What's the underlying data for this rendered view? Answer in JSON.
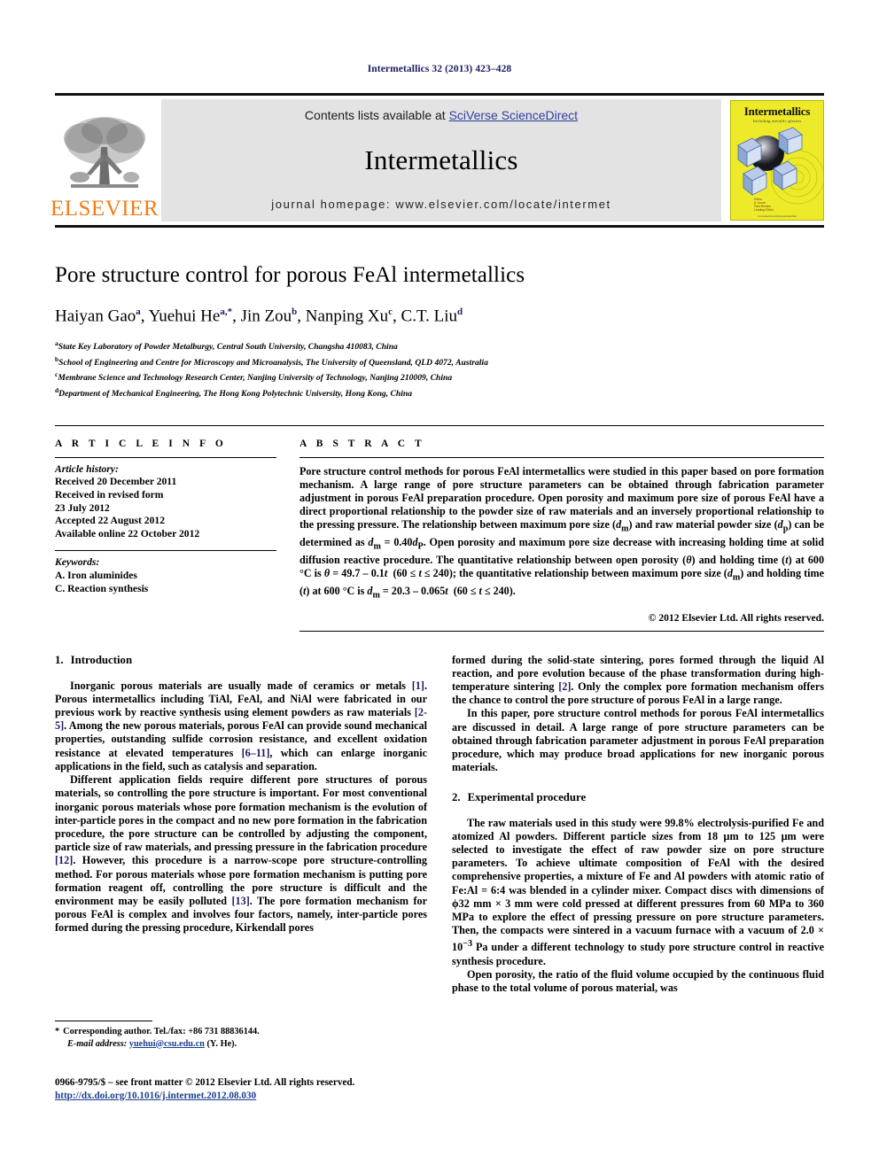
{
  "running_head": "Intermetallics 32 (2013) 423–428",
  "banner": {
    "publisher_name": "ELSEVIER",
    "publisher_logo_alt": "tree-icon",
    "contents_prefix": "Contents lists available at ",
    "contents_link": "SciVerse ScienceDirect",
    "journal_name": "Intermetallics",
    "homepage_label": "journal homepage: www.elsevier.com/locate/intermet",
    "cover": {
      "title": "Intermetallics",
      "subtitle": "Including metallic glasses",
      "footer": "www.elsevier.com/locate/intermet"
    },
    "link_color": "#2f3f9e"
  },
  "article": {
    "title": "Pore structure control for porous FeAl intermetallics",
    "authors_html": "Haiyan Gao<sup>a</sup>, Yuehui He<sup>a,*</sup>, Jin Zou<sup>b</sup>, Nanping Xu<sup>c</sup>, C.T. Liu<sup>d</sup>",
    "affiliations": [
      {
        "mark": "a",
        "text": "State Key Laboratory of Powder Metalburgy, Central South University, Changsha 410083, China"
      },
      {
        "mark": "b",
        "text": "School of Engineering and Centre for Microscopy and Microanalysis, The University of Queensland, QLD 4072, Australia"
      },
      {
        "mark": "c",
        "text": "Membrane Science and Technology Research Center, Nanjing University of Technology, Nanjing 210009, China"
      },
      {
        "mark": "d",
        "text": "Department of Mechanical Engineering, The Hong Kong Polytechnic University, Hong Kong, China"
      }
    ]
  },
  "article_info": {
    "heading": "A R T I C L E  I N F O",
    "history_label": "Article history:",
    "history": [
      "Received 20 December 2011",
      "Received in revised form",
      "23 July 2012",
      "Accepted 22 August 2012",
      "Available online 22 October 2012"
    ],
    "keywords_label": "Keywords:",
    "keywords": [
      "A. Iron aluminides",
      "C. Reaction synthesis"
    ]
  },
  "abstract": {
    "heading": "A B S T R A C T",
    "html": "Pore structure control methods for porous FeAl intermetallics were studied in this paper based on pore formation mechanism. A large range of pore structure parameters can be obtained through fabrication parameter adjustment in porous FeAl preparation procedure. Open porosity and maximum pore size of porous FeAl have a direct proportional relationship to the powder size of raw materials and an inversely proportional relationship to the pressing pressure. The relationship between maximum pore size (<i>d</i><sub>m</sub>) and raw material powder size (<i>d</i><sub>p</sub>) can be determined as <i>d</i><sub>m</sub> = 0.40<i>d</i><sub>P</sub>. Open porosity and maximum pore size decrease with increasing holding time at solid diffusion reactive procedure. The quantitative relationship between open porosity (<i>θ</i>) and holding time (<i>t</i>) at 600 °C is <i>θ</i> = 49.7 – 0.1<i>t</i>&nbsp;&nbsp;(60 ≤ <i>t</i> ≤ 240); the quantitative relationship between maximum pore size (<i>d</i><sub>m</sub>) and holding time (<i>t</i>) at 600 °C is <i>d</i><sub>m</sub> = 20.3 – 0.065<i>t</i>&nbsp;&nbsp;(60 ≤ <i>t</i> ≤ 240).",
    "copyright": "© 2012 Elsevier Ltd. All rights reserved."
  },
  "sections": {
    "intro": {
      "number": "1.",
      "title": "Introduction",
      "p1_html": "Inorganic porous materials are usually made of ceramics or metals <span class=\"ref\">[1]</span>. Porous intermetallics including TiAl, FeAl, and NiAl were fabricated in our previous work by reactive synthesis using element powders as raw materials <span class=\"ref\">[2-5]</span>. Among the new porous materials, porous FeAl can provide sound mechanical properties, outstanding sulfide corrosion resistance, and excellent oxidation resistance at elevated temperatures <span class=\"ref\">[6–11]</span>, which can enlarge inorganic applications in the field, such as catalysis and separation.",
      "p2_html": "Different application fields require different pore structures of porous materials, so controlling the pore structure is important. For most conventional inorganic porous materials whose pore formation mechanism is the evolution of inter-particle pores in the compact and no new pore formation in the fabrication procedure, the pore structure can be controlled by adjusting the component, particle size of raw materials, and pressing pressure in the fabrication procedure <span class=\"ref\">[12]</span>. However, this procedure is a narrow-scope pore structure-controlling method. For porous materials whose pore formation mechanism is putting pore formation reagent off, controlling the pore structure is difficult and the environment may be easily polluted <span class=\"ref\">[13]</span>. The pore formation mechanism for porous FeAl is complex and involves four factors, namely, inter-particle pores formed during the pressing procedure, Kirkendall pores",
      "p3_html": "formed during the solid-state sintering, pores formed through the liquid Al reaction, and pore evolution because of the phase transformation during high-temperature sintering <span class=\"ref\">[2]</span>. Only the complex pore formation mechanism offers the chance to control the pore structure of porous FeAl in a large range.",
      "p4_html": "In this paper, pore structure control methods for porous FeAl intermetallics are discussed in detail. A large range of pore structure parameters can be obtained through fabrication parameter adjustment in porous FeAl preparation procedure, which may produce broad applications for new inorganic porous materials."
    },
    "experimental": {
      "number": "2.",
      "title": "Experimental procedure",
      "p1_html": "The raw materials used in this study were 99.8% electrolysis-purified Fe and atomized Al powders. Different particle sizes from 18 μm to 125 μm were selected to investigate the effect of raw powder size on pore structure parameters. To achieve ultimate composition of FeAl with the desired comprehensive properties, a mixture of Fe and Al powders with atomic ratio of Fe:Al = 6:4 was blended in a cylinder mixer. Compact discs with dimensions of ϕ32 mm × 3 mm were cold pressed at different pressures from 60 MPa to 360 MPa to explore the effect of pressing pressure on pore structure parameters. Then, the compacts were sintered in a vacuum furnace with a vacuum of 2.0 × 10<sup>−3</sup> Pa under a different technology to study pore structure control in reactive synthesis procedure.",
      "p2_html": "Open porosity, the ratio of the fluid volume occupied by the continuous fluid phase to the total volume of porous material, was"
    }
  },
  "footnote": {
    "star": "*",
    "corresponding_html": "Corresponding author. Tel./fax: +86 731 88836144.",
    "email_label": "E-mail address:",
    "email": "yuehui@csu.edu.cn",
    "email_suffix": "(Y. He)."
  },
  "footer": {
    "issn_line": "0966-9795/$ – see front matter © 2012 Elsevier Ltd. All rights reserved.",
    "doi": "http://dx.doi.org/10.1016/j.intermet.2012.08.030"
  }
}
